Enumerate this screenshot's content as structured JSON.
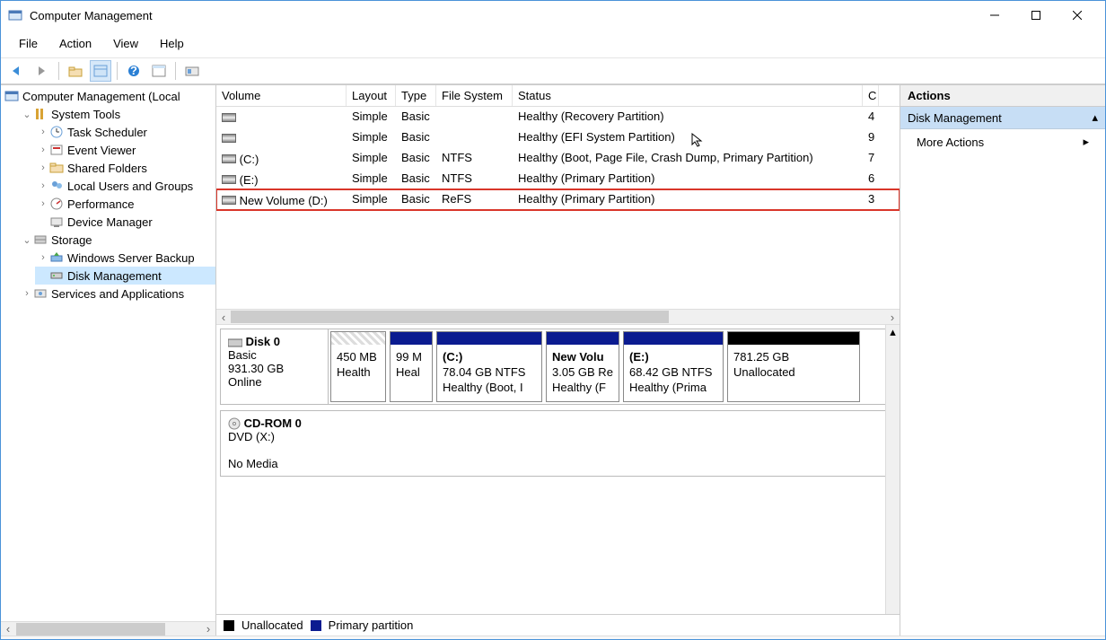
{
  "window": {
    "title": "Computer Management"
  },
  "menu": {
    "file": "File",
    "action": "Action",
    "view": "View",
    "help": "Help"
  },
  "tree": {
    "root": "Computer Management (Local",
    "systools": "System Tools",
    "task": "Task Scheduler",
    "event": "Event Viewer",
    "shared": "Shared Folders",
    "users": "Local Users and Groups",
    "perf": "Performance",
    "devmgr": "Device Manager",
    "storage": "Storage",
    "wsb": "Windows Server Backup",
    "diskmgmt": "Disk Management",
    "services": "Services and Applications"
  },
  "actions": {
    "header": "Actions",
    "section": "Disk Management",
    "more": "More Actions"
  },
  "cols": {
    "volume": "Volume",
    "layout": "Layout",
    "type": "Type",
    "fs": "File System",
    "status": "Status",
    "c": "C"
  },
  "rows": [
    {
      "vol": "",
      "layout": "Simple",
      "type": "Basic",
      "fs": "",
      "status": "Healthy (Recovery Partition)",
      "c": "4"
    },
    {
      "vol": "",
      "layout": "Simple",
      "type": "Basic",
      "fs": "",
      "status": "Healthy (EFI System Partition)",
      "c": "9"
    },
    {
      "vol": "(C:)",
      "layout": "Simple",
      "type": "Basic",
      "fs": "NTFS",
      "status": "Healthy (Boot, Page File, Crash Dump, Primary Partition)",
      "c": "7"
    },
    {
      "vol": "(E:)",
      "layout": "Simple",
      "type": "Basic",
      "fs": "NTFS",
      "status": "Healthy (Primary Partition)",
      "c": "6"
    },
    {
      "vol": "New Volume (D:)",
      "layout": "Simple",
      "type": "Basic",
      "fs": "ReFS",
      "status": "Healthy (Primary Partition)",
      "c": "3"
    }
  ],
  "disk0": {
    "name": "Disk 0",
    "basic": "Basic",
    "size": "931.30 GB",
    "online": "Online",
    "p0a": "450 MB",
    "p0b": "Health",
    "p1a": "99 M",
    "p1b": "Heal",
    "p2t": "(C:)",
    "p2a": "78.04 GB NTFS",
    "p2b": "Healthy (Boot, I",
    "p3t": "New Volu",
    "p3a": "3.05 GB Re",
    "p3b": "Healthy (F",
    "p4t": "(E:)",
    "p4a": "68.42 GB NTFS",
    "p4b": "Healthy (Prima",
    "p5a": "781.25 GB",
    "p5b": "Unallocated"
  },
  "cdrom": {
    "name": "CD-ROM 0",
    "dvd": "DVD (X:)",
    "nomedia": "No Media"
  },
  "legend": {
    "unalloc": "Unallocated",
    "primary": "Primary partition"
  }
}
